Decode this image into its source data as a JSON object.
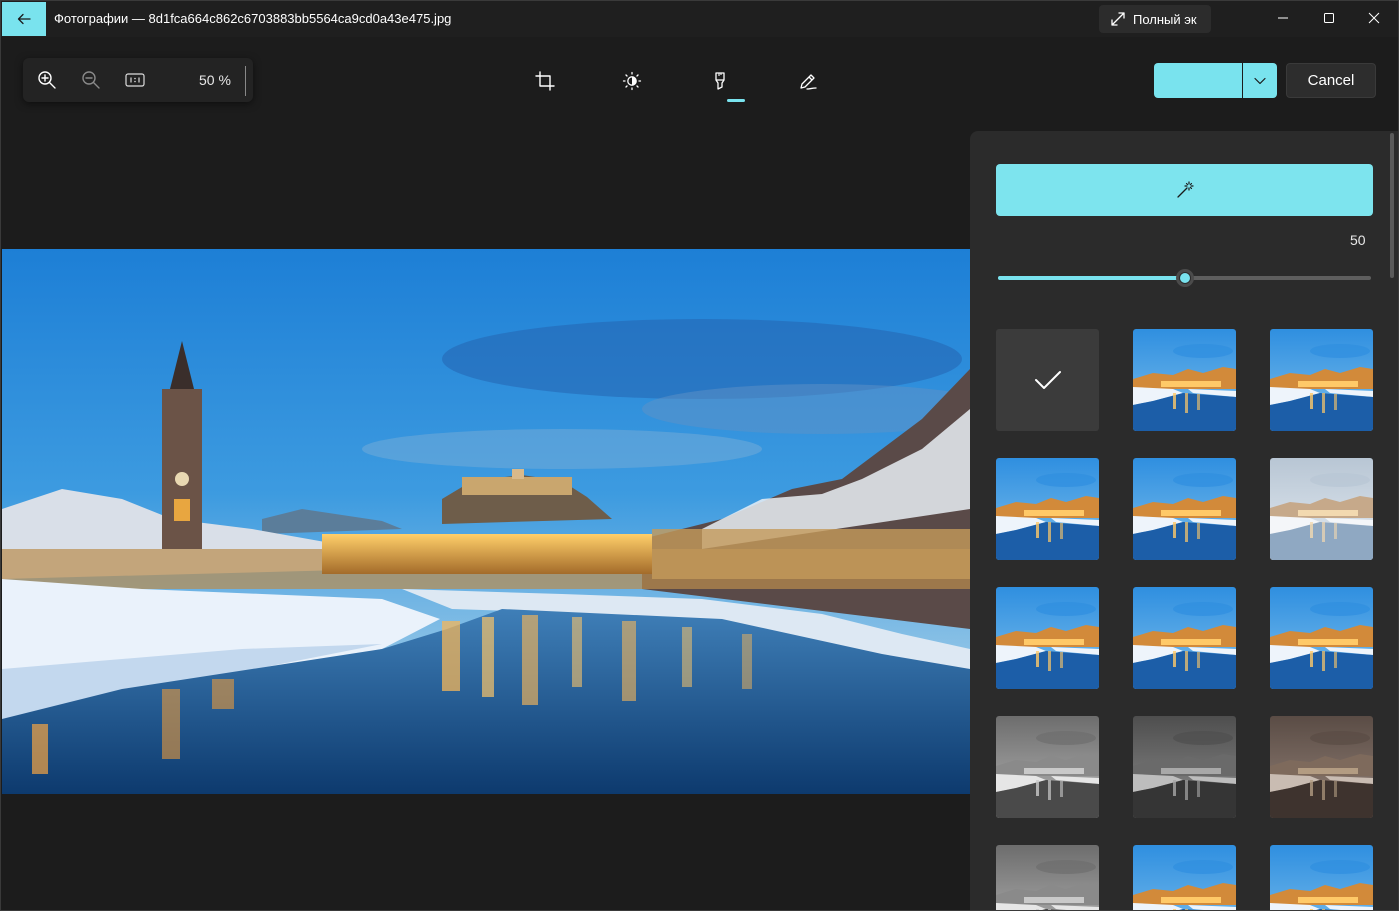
{
  "app": {
    "title": "Фотографии — 8d1fca664c862c6703883bb5564ca9cd0a43e475.jpg",
    "fullscreen_label": "Полный эк",
    "accent": "#79e3ee"
  },
  "zoom": {
    "level": "50 %"
  },
  "toolbar": {
    "tools": [
      "crop-icon",
      "adjust-brightness-icon",
      "filter-icon",
      "markup-icon"
    ],
    "active_tool": "filter-icon",
    "save_label": "",
    "cancel_label": "Cancel"
  },
  "panel": {
    "enhance_icon": "magic-wand-icon",
    "intensity_value": "50",
    "intensity": 0.5,
    "filters": [
      {
        "id": "none",
        "style": "none",
        "selected": true
      },
      {
        "id": "f1",
        "style": "color"
      },
      {
        "id": "f2",
        "style": "color"
      },
      {
        "id": "f3",
        "style": "color"
      },
      {
        "id": "f4",
        "style": "color"
      },
      {
        "id": "f5",
        "style": "faded"
      },
      {
        "id": "f6",
        "style": "color"
      },
      {
        "id": "f7",
        "style": "color"
      },
      {
        "id": "f8",
        "style": "color"
      },
      {
        "id": "f9",
        "style": "mono"
      },
      {
        "id": "f10",
        "style": "mono-dark"
      },
      {
        "id": "f11",
        "style": "sepia"
      },
      {
        "id": "f12",
        "style": "mono"
      },
      {
        "id": "f13",
        "style": "color"
      },
      {
        "id": "f14",
        "style": "color"
      }
    ]
  }
}
